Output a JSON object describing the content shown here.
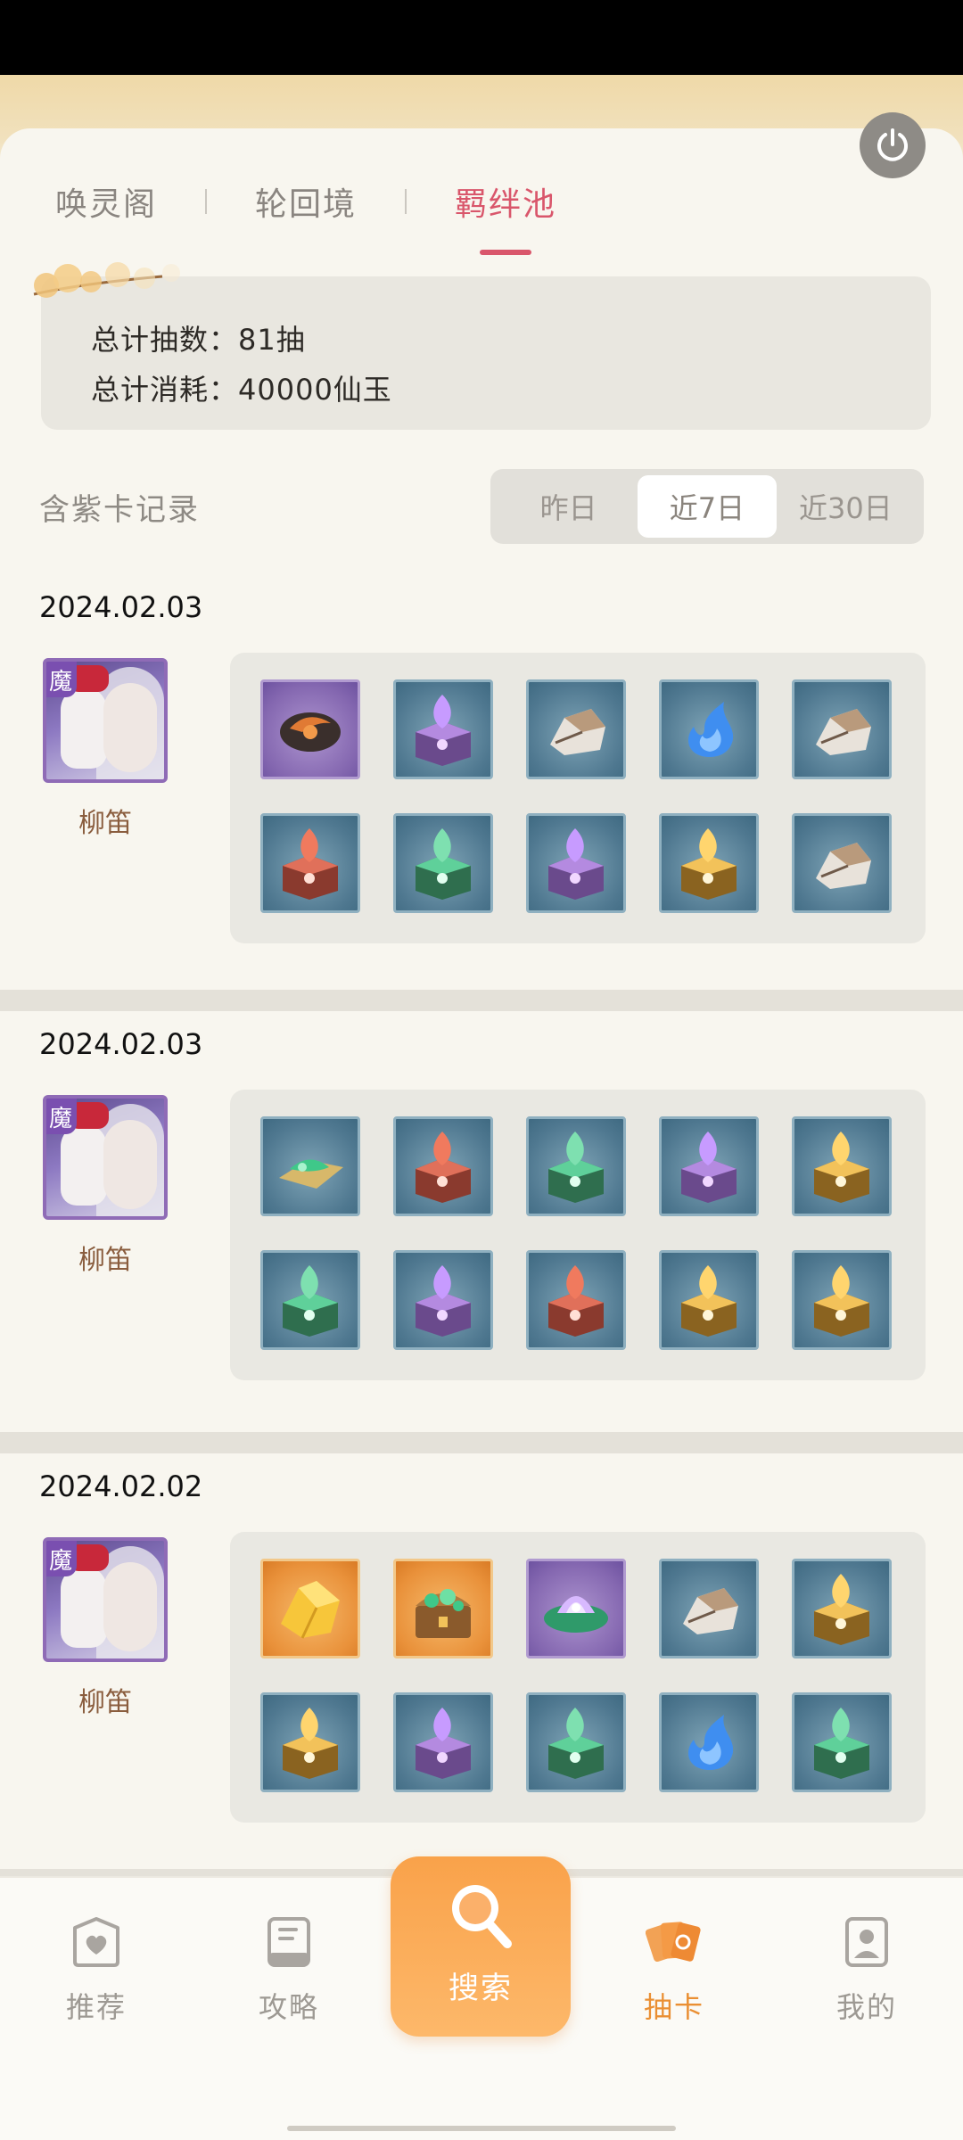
{
  "tabs": [
    {
      "label": "唤灵阁",
      "active": false
    },
    {
      "label": "轮回境",
      "active": false
    },
    {
      "label": "羁绊池",
      "active": true
    }
  ],
  "summary": {
    "total_draws": "总计抽数：81抽",
    "total_cost": "总计消耗：40000仙玉"
  },
  "section": {
    "title": "含紫卡记录",
    "filters": [
      {
        "label": "昨日",
        "active": false
      },
      {
        "label": "近7日",
        "active": true
      },
      {
        "label": "近30日",
        "active": false
      }
    ]
  },
  "records": [
    {
      "date": "2024.02.03",
      "character": {
        "name": "柳笛",
        "badge": "魔"
      },
      "items": [
        {
          "frame": "purple",
          "icon": "dark-stone-icon"
        },
        {
          "frame": "blue",
          "icon": "purple-chest-icon"
        },
        {
          "frame": "blue",
          "icon": "rock-icon"
        },
        {
          "frame": "blue",
          "icon": "blue-flame-icon"
        },
        {
          "frame": "blue",
          "icon": "rock-icon"
        },
        {
          "frame": "blue",
          "icon": "red-chest-icon"
        },
        {
          "frame": "blue",
          "icon": "green-chest-icon"
        },
        {
          "frame": "blue",
          "icon": "purple-chest-icon"
        },
        {
          "frame": "blue",
          "icon": "gold-chest-icon"
        },
        {
          "frame": "blue",
          "icon": "rock-icon"
        }
      ]
    },
    {
      "date": "2024.02.03",
      "character": {
        "name": "柳笛",
        "badge": "魔"
      },
      "items": [
        {
          "frame": "blue",
          "icon": "jade-leaf-icon"
        },
        {
          "frame": "blue",
          "icon": "red-chest-icon"
        },
        {
          "frame": "blue",
          "icon": "green-chest-icon"
        },
        {
          "frame": "blue",
          "icon": "purple-chest-icon"
        },
        {
          "frame": "blue",
          "icon": "gold-chest-icon"
        },
        {
          "frame": "blue",
          "icon": "green-chest-icon"
        },
        {
          "frame": "blue",
          "icon": "purple-chest-icon"
        },
        {
          "frame": "blue",
          "icon": "red-chest-icon"
        },
        {
          "frame": "blue",
          "icon": "gold-chest-icon"
        },
        {
          "frame": "blue",
          "icon": "gold-chest-icon"
        }
      ]
    },
    {
      "date": "2024.02.02",
      "character": {
        "name": "柳笛",
        "badge": "魔"
      },
      "items": [
        {
          "frame": "gold",
          "icon": "gold-ingot-icon"
        },
        {
          "frame": "gold",
          "icon": "treasure-chest-icon"
        },
        {
          "frame": "purple",
          "icon": "lotus-gem-icon"
        },
        {
          "frame": "blue",
          "icon": "rock-icon"
        },
        {
          "frame": "blue",
          "icon": "gold-chest-icon"
        },
        {
          "frame": "blue",
          "icon": "gold-chest-icon"
        },
        {
          "frame": "blue",
          "icon": "purple-chest-icon"
        },
        {
          "frame": "blue",
          "icon": "green-chest-icon"
        },
        {
          "frame": "blue",
          "icon": "blue-flame-icon"
        },
        {
          "frame": "blue",
          "icon": "green-chest-icon"
        }
      ]
    }
  ],
  "nav": [
    {
      "label": "推荐",
      "icon": "heart-card-icon",
      "active": false
    },
    {
      "label": "攻略",
      "icon": "guide-book-icon",
      "active": false
    },
    {
      "label": "搜索",
      "icon": "search-icon",
      "active": false
    },
    {
      "label": "抽卡",
      "icon": "cards-icon",
      "active": true
    },
    {
      "label": "我的",
      "icon": "profile-icon",
      "active": false
    }
  ],
  "colors": {
    "accent": "#d9566b",
    "nav_active": "#ea8f33",
    "search_button": "#fbab57"
  }
}
